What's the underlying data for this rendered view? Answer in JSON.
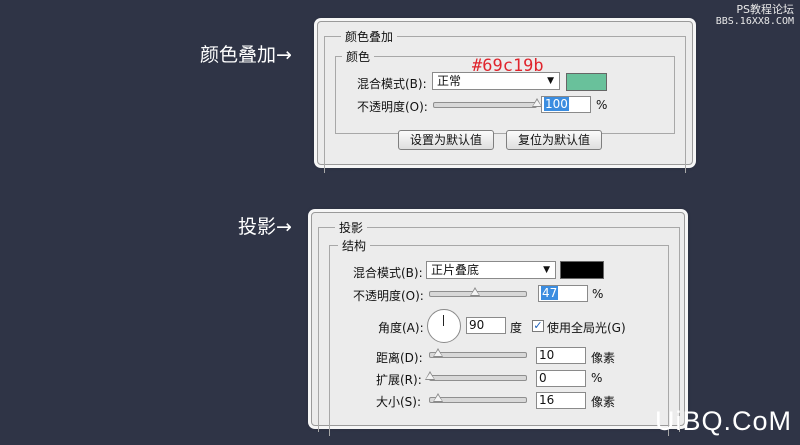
{
  "watermark_top": {
    "line1": "PS教程论坛",
    "line2": "BBS.16XX8.COM"
  },
  "watermark_bottom": "UiBQ.CoM",
  "labels": {
    "color_overlay": "颜色叠加→",
    "drop_shadow": "投影→"
  },
  "color_overlay": {
    "title": "颜色叠加",
    "group": "颜色",
    "color_note": "#69c19b",
    "blend_mode_label": "混合模式(B):",
    "blend_mode_value": "正常",
    "color": "#69c19b",
    "opacity_label": "不透明度(O):",
    "opacity_value": "100",
    "opacity_unit": "%",
    "opacity": 100,
    "btn_set_default": "设置为默认值",
    "btn_reset_default": "复位为默认值"
  },
  "drop_shadow": {
    "title": "投影",
    "group": "结构",
    "blend_mode_label": "混合模式(B):",
    "blend_mode_value": "正片叠底",
    "color": "#000000",
    "opacity_label": "不透明度(O):",
    "opacity_value": "47",
    "opacity_unit": "%",
    "opacity": 47,
    "angle_label": "角度(A):",
    "angle_value": "90",
    "angle_unit": "度",
    "global_light_label": "使用全局光(G)",
    "global_light_checked": true,
    "distance_label": "距离(D):",
    "distance_value": "10",
    "distance_unit": "像素",
    "spread_label": "扩展(R):",
    "spread_value": "0",
    "spread_unit": "%",
    "size_label": "大小(S):",
    "size_value": "16",
    "size_unit": "像素"
  }
}
